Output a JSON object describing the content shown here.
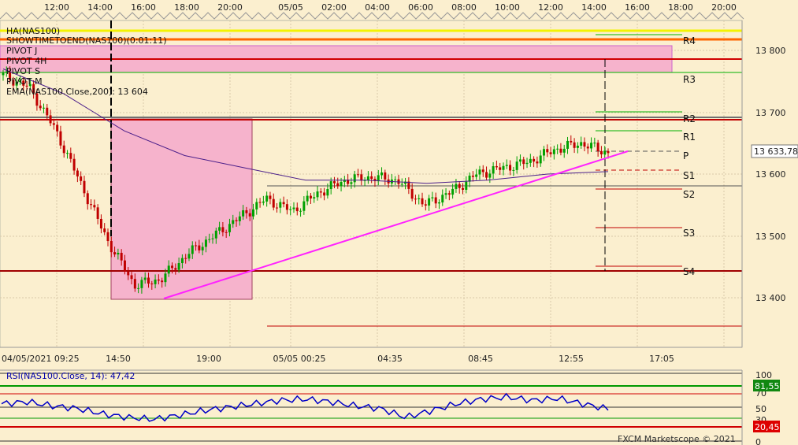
{
  "colors": {
    "background": "#fbefcf",
    "grid": "#d8caa8",
    "ema": "#4b1f8a",
    "trend": "#ff22ff",
    "pink_box": "#f6b3cc",
    "support": "#c00000",
    "resistance_green": "#00b000",
    "yellow": "#f3f300",
    "orange": "#ff6600",
    "rsi_line": "#0000c8",
    "rsi_green": "#009900",
    "rsi_red": "#d00000",
    "bull_candle": "#00a000",
    "bear_candle": "#c00000"
  },
  "top_axis": {
    "labels": [
      "12:00",
      "14:00",
      "16:00",
      "18:00",
      "20:00",
      "05/05",
      "02:00",
      "04:00",
      "06:00",
      "08:00",
      "10:00",
      "12:00",
      "14:00",
      "16:00",
      "18:00",
      "20:00"
    ]
  },
  "bottom_axis": {
    "labels": [
      "04/05/2021 09:25",
      "14:50",
      "19:00",
      "05/05 00:25",
      "04:35",
      "08:45",
      "12:55",
      "17:05"
    ]
  },
  "right_axis": {
    "labels": [
      "13 800",
      "13 700",
      "13 600",
      "13 500",
      "13 400"
    ],
    "last_price": "13 633,78"
  },
  "indicators": [
    "HA(NAS100)",
    "SHOWTIMETOEND(NAS100)(0:01:11)",
    "PIVOT J",
    "PIVOT 4H",
    "PIVOT S",
    "PIVOT M",
    "EMA(NAS100.Close,200): 13 604"
  ],
  "pivot_labels": [
    "R4",
    "R3",
    "R2",
    "R1",
    "P",
    "S1",
    "S2",
    "S3",
    "S4"
  ],
  "rsi": {
    "title": "RSI(NAS100.Close, 14): 47,42",
    "axis_labels": [
      "100",
      "70",
      "50",
      "30",
      "0"
    ],
    "upper_value": "81,55",
    "lower_value": "20,45"
  },
  "watermark": "FXCM Marketscope © 2021",
  "chart_data": {
    "type": "line",
    "title": "NAS100",
    "ylim": [
      13350,
      13850
    ],
    "series": [
      {
        "name": "NAS100",
        "x": [
          "04/05 11:00",
          "04/05 13:00",
          "04/05 14:50",
          "04/05 15:30",
          "04/05 16:20",
          "04/05 17:10",
          "04/05 18:00",
          "04/05 19:00",
          "04/05 20:00",
          "04/05 21:00",
          "04/05 21:40",
          "05/05 00:25",
          "05/05 02:00",
          "05/05 03:00",
          "05/05 04:35",
          "05/05 05:40",
          "05/05 07:00",
          "05/05 08:00",
          "05/05 09:20",
          "05/05 10:30",
          "05/05 11:40",
          "05/05 12:55",
          "05/05 14:00",
          "05/05 14:30"
        ],
        "values": [
          13760,
          13740,
          13670,
          13580,
          13490,
          13420,
          13430,
          13470,
          13500,
          13530,
          13560,
          13540,
          13570,
          13590,
          13595,
          13590,
          13550,
          13570,
          13600,
          13610,
          13620,
          13640,
          13650,
          13634
        ]
      },
      {
        "name": "EMA 200",
        "x": [
          "04/05 11:00",
          "04/05 14:50",
          "04/05 17:10",
          "04/05 19:00",
          "04/05 21:40",
          "05/05 02:00",
          "05/05 04:35",
          "05/05 07:00",
          "05/05 09:20",
          "05/05 12:55",
          "05/05 14:30"
        ],
        "values": [
          13770,
          13730,
          13670,
          13630,
          13610,
          13590,
          13590,
          13585,
          13590,
          13600,
          13604
        ]
      }
    ],
    "pivots": {
      "R4": 13813,
      "R3": 13765,
      "R2": 13700,
      "R1": 13668,
      "P": 13634,
      "S1": 13606,
      "S2": 13574,
      "S3": 13512,
      "S4": 13450
    },
    "horizontal_levels": [
      13836,
      13822,
      13786,
      13764,
      13690,
      13686,
      13580,
      13442,
      13395,
      13355
    ],
    "rsi_series": [
      55,
      58,
      52,
      48,
      40,
      35,
      32,
      38,
      45,
      50,
      55,
      60,
      62,
      58,
      52,
      48,
      35,
      45,
      55,
      62,
      65,
      60,
      63,
      55,
      47.42
    ],
    "rsi_levels": [
      70,
      50,
      30
    ]
  }
}
